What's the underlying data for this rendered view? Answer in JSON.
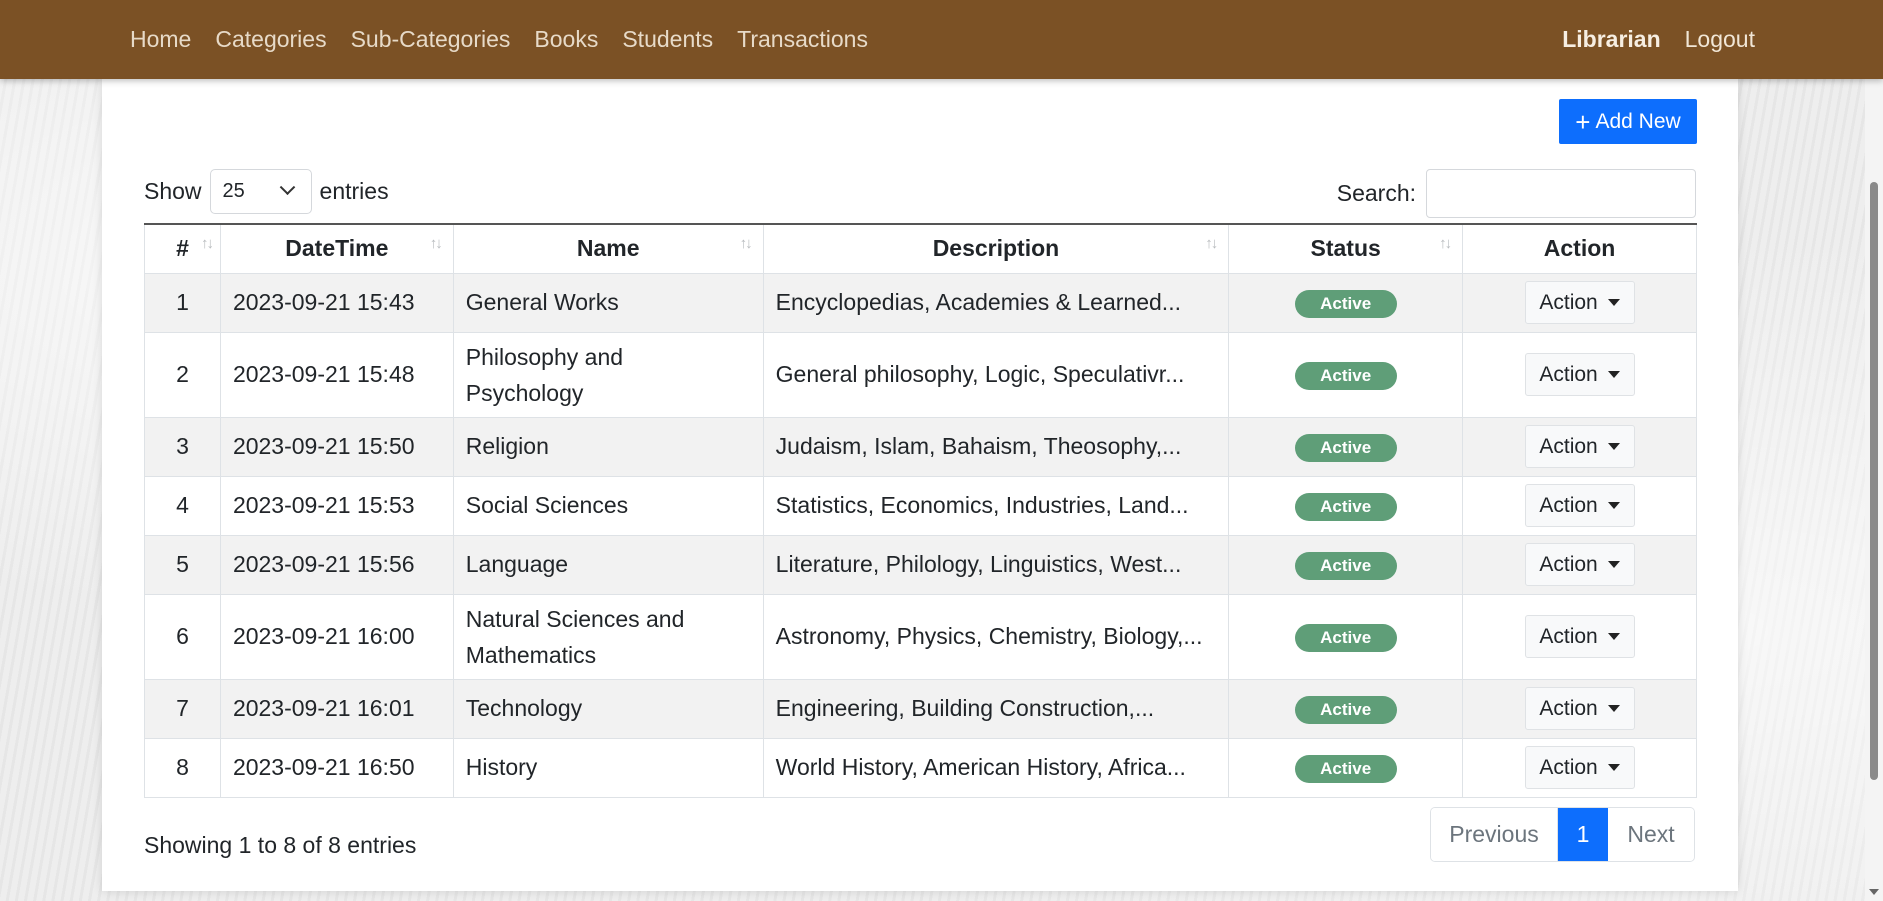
{
  "nav": {
    "links": [
      "Home",
      "Categories",
      "Sub-Categories",
      "Books",
      "Students",
      "Transactions"
    ],
    "user": "Librarian",
    "logout": "Logout"
  },
  "toolbar": {
    "add_label": "Add New",
    "add_icon": "+"
  },
  "length": {
    "show": "Show",
    "value": "25",
    "entries": "entries"
  },
  "search": {
    "label": "Search:",
    "value": ""
  },
  "table": {
    "headers": [
      "#",
      "DateTime",
      "Name",
      "Description",
      "Status",
      "Action"
    ],
    "sort_icon": "↑↓",
    "rows": [
      {
        "num": "1",
        "datetime": "2023-09-21 15:43",
        "name": "General Works",
        "description": "Encyclopedias, Academies & Learned...",
        "status": "Active",
        "action": "Action"
      },
      {
        "num": "2",
        "datetime": "2023-09-21 15:48",
        "name": "Philosophy and Psychology",
        "description": "General philosophy, Logic, Speculativr...",
        "status": "Active",
        "action": "Action"
      },
      {
        "num": "3",
        "datetime": "2023-09-21 15:50",
        "name": "Religion",
        "description": "Judaism, Islam, Bahaism, Theosophy,...",
        "status": "Active",
        "action": "Action"
      },
      {
        "num": "4",
        "datetime": "2023-09-21 15:53",
        "name": "Social Sciences",
        "description": "Statistics, Economics, Industries, Land...",
        "status": "Active",
        "action": "Action"
      },
      {
        "num": "5",
        "datetime": "2023-09-21 15:56",
        "name": "Language",
        "description": "Literature, Philology, Linguistics, West...",
        "status": "Active",
        "action": "Action"
      },
      {
        "num": "6",
        "datetime": "2023-09-21 16:00",
        "name": "Natural Sciences and Mathematics",
        "description": "Astronomy, Physics, Chemistry, Biology,...",
        "status": "Active",
        "action": "Action"
      },
      {
        "num": "7",
        "datetime": "2023-09-21 16:01",
        "name": "Technology",
        "description": "Engineering, Building Construction,...",
        "status": "Active",
        "action": "Action"
      },
      {
        "num": "8",
        "datetime": "2023-09-21 16:50",
        "name": "History",
        "description": "World History, American History, Africa...",
        "status": "Active",
        "action": "Action"
      }
    ]
  },
  "info": "Showing 1 to 8 of 8 entries",
  "pagination": {
    "previous": "Previous",
    "current": "1",
    "next": "Next"
  },
  "colors": {
    "navbar": "#7b5125",
    "primary": "#0d6efd",
    "badge": "#5f9e78"
  }
}
